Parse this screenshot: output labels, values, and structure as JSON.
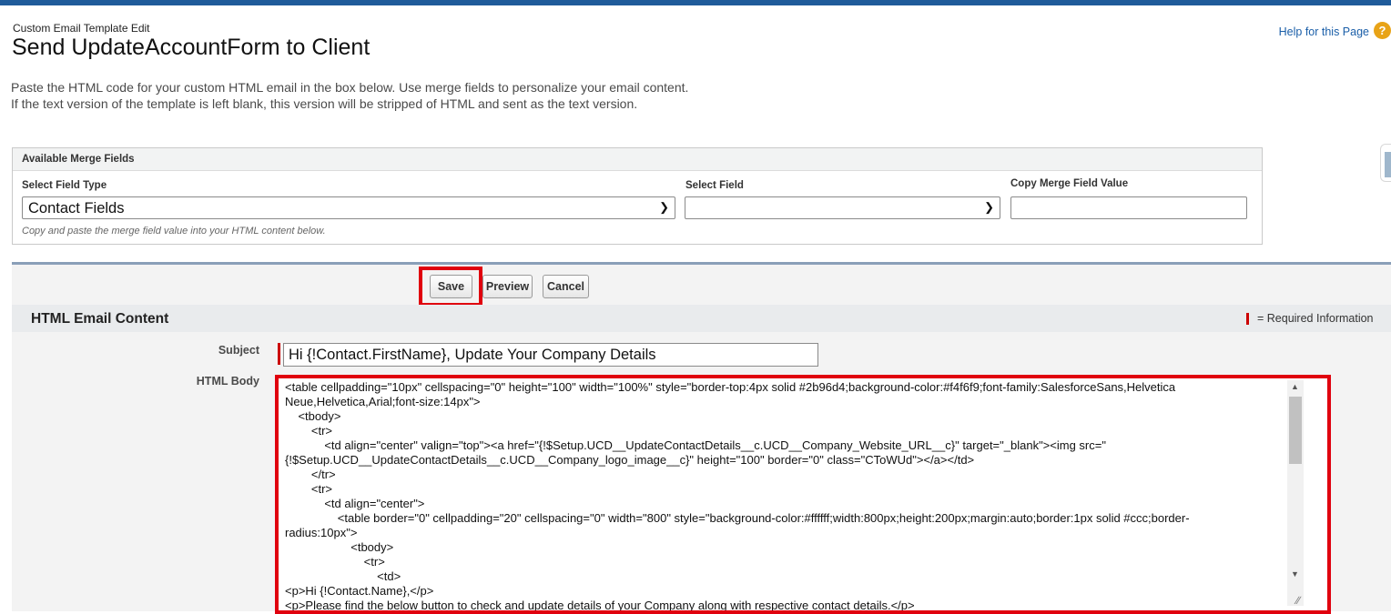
{
  "page": {
    "type_label": "Custom Email Template Edit",
    "title": "Send UpdateAccountForm to Client",
    "help_link": "Help for this Page",
    "help_icon": "?",
    "intro_lines": [
      "Paste the HTML code for your custom HTML email in the box below. Use merge fields to personalize your email content.",
      "If the text version of the template is left blank, this version will be stripped of HTML and sent as the text version."
    ]
  },
  "merge_fields": {
    "header": "Available Merge Fields",
    "field_type_label": "Select Field Type",
    "field_type_value": "Contact Fields",
    "field_label": "Select Field",
    "field_value": "",
    "copy_label": "Copy Merge Field Value",
    "copy_value": "",
    "note": "Copy and paste the merge field value into your HTML content below."
  },
  "buttons": {
    "save": "Save",
    "preview": "Preview",
    "cancel": "Cancel"
  },
  "section": {
    "title": "HTML Email Content",
    "required_legend": "= Required Information"
  },
  "form": {
    "subject_label": "Subject",
    "subject_value": "Hi {!Contact.FirstName}, Update Your Company Details",
    "body_label": "HTML Body",
    "body_lines": [
      "<table cellpadding=\"10px\" cellspacing=\"0\" height=\"100\" width=\"100%\" style=\"border-top:4px solid #2b96d4;background-color:#f4f6f9;font-family:SalesforceSans,Helvetica",
      "Neue,Helvetica,Arial;font-size:14px\">",
      "    <tbody>",
      "        <tr>",
      "            <td align=\"center\" valign=\"top\"><a href=\"{!$Setup.UCD__UpdateContactDetails__c.UCD__Company_Website_URL__c}\" target=\"_blank\"><img src=\"",
      "{!$Setup.UCD__UpdateContactDetails__c.UCD__Company_logo_image__c}\" height=\"100\" border=\"0\" class=\"CToWUd\"></a></td>",
      "        </tr>",
      "        <tr>",
      "            <td align=\"center\">",
      "                <table border=\"0\" cellpadding=\"20\" cellspacing=\"0\" width=\"800\" style=\"background-color:#ffffff;width:800px;height:200px;margin:auto;border:1px solid #ccc;border-",
      "radius:10px\">",
      "                    <tbody>",
      "                        <tr>",
      "                            <td>",
      "<p>Hi {!Contact.Name},</p>",
      "<p>Please find the below button to check and update details of your Company along with respective contact details.</p>"
    ]
  },
  "colors": {
    "highlight": "#e0000e",
    "required": "#cc0000",
    "link": "#1a5ea8"
  }
}
